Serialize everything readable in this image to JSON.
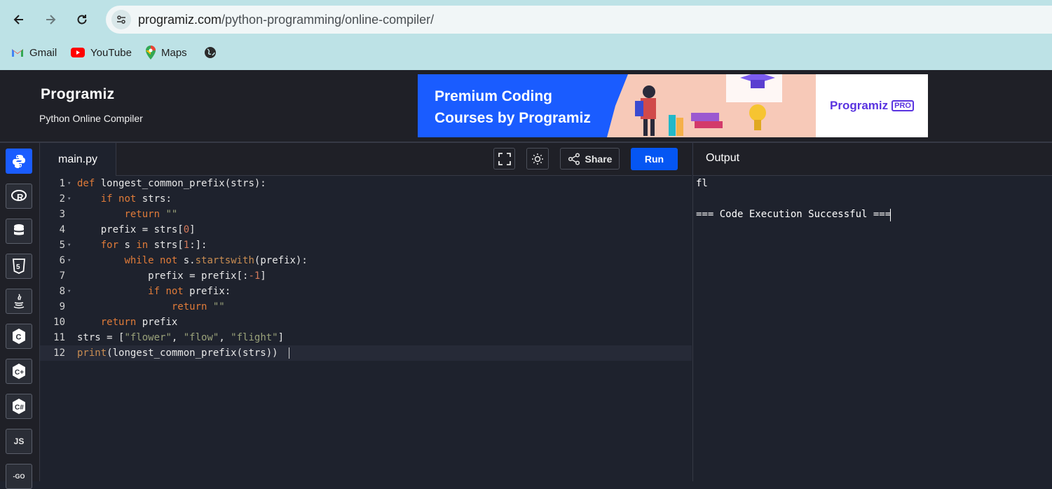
{
  "browser": {
    "url_host": "programiz.com",
    "url_path": "/python-programming/online-compiler/",
    "bookmarks": [
      {
        "label": "Gmail",
        "icon": "gmail-icon"
      },
      {
        "label": "YouTube",
        "icon": "youtube-icon"
      },
      {
        "label": "Maps",
        "icon": "maps-icon"
      },
      {
        "label": "",
        "icon": "globe-icon"
      }
    ]
  },
  "header": {
    "logo": "Programiz",
    "subtitle": "Python Online Compiler",
    "banner": {
      "line1": "Premium Coding",
      "line2": "Courses by Programiz",
      "brand": "Programiz",
      "badge": "PRO"
    }
  },
  "sidebar": {
    "languages": [
      {
        "name": "python-icon",
        "label": "",
        "active": true
      },
      {
        "name": "r-icon",
        "label": "R"
      },
      {
        "name": "sql-icon",
        "label": ""
      },
      {
        "name": "html5-icon",
        "label": "5"
      },
      {
        "name": "java-icon",
        "label": ""
      },
      {
        "name": "c-icon",
        "label": "C"
      },
      {
        "name": "cpp-icon",
        "label": "C+"
      },
      {
        "name": "csharp-icon",
        "label": "C#"
      },
      {
        "name": "js-icon",
        "label": "JS"
      },
      {
        "name": "go-icon",
        "label": "-GO"
      }
    ]
  },
  "editor": {
    "filename": "main.py",
    "share_label": "Share",
    "run_label": "Run",
    "active_line": 12,
    "lines": [
      {
        "n": "1",
        "fold": true,
        "html": "<span class=\"kw\">def</span> longest_common_prefix(strs):"
      },
      {
        "n": "2",
        "fold": true,
        "html": "    <span class=\"kw\">if</span> <span class=\"kw\">not</span> strs:"
      },
      {
        "n": "3",
        "fold": false,
        "html": "        <span class=\"kw\">return</span> <span class=\"str\">\"\"</span>"
      },
      {
        "n": "4",
        "fold": false,
        "html": "    prefix = strs[<span class=\"num\">0</span>]"
      },
      {
        "n": "5",
        "fold": true,
        "html": "    <span class=\"kw\">for</span> s <span class=\"kw\">in</span> strs[<span class=\"num\">1</span>:]:"
      },
      {
        "n": "6",
        "fold": true,
        "html": "        <span class=\"kw\">while</span> <span class=\"kw\">not</span> s.<span class=\"fn\">startswith</span>(prefix):"
      },
      {
        "n": "7",
        "fold": false,
        "html": "            prefix = prefix[:<span class=\"num\">-1</span>]"
      },
      {
        "n": "8",
        "fold": true,
        "html": "            <span class=\"kw\">if</span> <span class=\"kw\">not</span> prefix:"
      },
      {
        "n": "9",
        "fold": false,
        "html": "                <span class=\"kw\">return</span> <span class=\"str\">\"\"</span>"
      },
      {
        "n": "10",
        "fold": false,
        "html": "    <span class=\"kw\">return</span> prefix"
      },
      {
        "n": "11",
        "fold": false,
        "html": "strs = [<span class=\"str\">\"flower\"</span>, <span class=\"str\">\"flow\"</span>, <span class=\"str\">\"flight\"</span>]"
      },
      {
        "n": "12",
        "fold": false,
        "html": "<span class=\"fn\">print</span>(longest_common_prefix(strs))"
      }
    ]
  },
  "output": {
    "title": "Output",
    "lines": [
      "fl",
      "",
      "=== Code Execution Successful ==="
    ]
  },
  "colors": {
    "accent": "#0556f3",
    "keyword": "#e07b39",
    "string": "#9aa27a"
  }
}
